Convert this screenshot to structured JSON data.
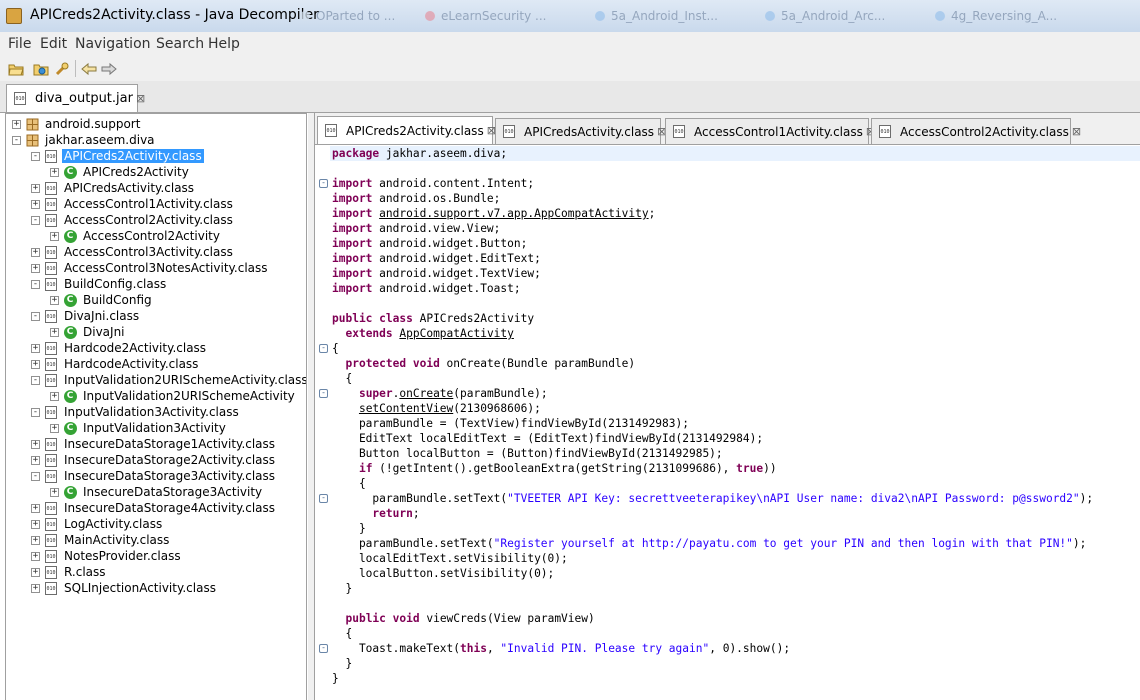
{
  "window": {
    "title": "APICreds2Activity.class - Java Decompiler",
    "background_tabs": [
      "OParted to ...",
      "eLearnSecurity ...",
      "5a_Android_Inst...",
      "5a_Android_Arc...",
      "4g_Reversing_A..."
    ]
  },
  "menu": [
    "File",
    "Edit",
    "Navigation",
    "Search",
    "Help"
  ],
  "toolbar": {
    "buttons": [
      "open-file-icon",
      "open-type-icon",
      "search-icon",
      "back-arrow-icon",
      "forward-arrow-icon"
    ]
  },
  "outer_tab": {
    "label": "diva_output.jar",
    "close": "⊠"
  },
  "tree": [
    {
      "indent": 0,
      "toggle": "+",
      "icon": "package",
      "label": "android.support"
    },
    {
      "indent": 0,
      "toggle": "-",
      "icon": "package",
      "label": "jakhar.aseem.diva"
    },
    {
      "indent": 1,
      "toggle": "-",
      "icon": "file",
      "label": "APICreds2Activity.class",
      "selected": true
    },
    {
      "indent": 2,
      "toggle": "+",
      "icon": "class",
      "label": "APICreds2Activity"
    },
    {
      "indent": 1,
      "toggle": "+",
      "icon": "file",
      "label": "APICredsActivity.class"
    },
    {
      "indent": 1,
      "toggle": "+",
      "icon": "file",
      "label": "AccessControl1Activity.class"
    },
    {
      "indent": 1,
      "toggle": "-",
      "icon": "file",
      "label": "AccessControl2Activity.class"
    },
    {
      "indent": 2,
      "toggle": "+",
      "icon": "class",
      "label": "AccessControl2Activity"
    },
    {
      "indent": 1,
      "toggle": "+",
      "icon": "file",
      "label": "AccessControl3Activity.class"
    },
    {
      "indent": 1,
      "toggle": "+",
      "icon": "file",
      "label": "AccessControl3NotesActivity.class"
    },
    {
      "indent": 1,
      "toggle": "-",
      "icon": "file",
      "label": "BuildConfig.class"
    },
    {
      "indent": 2,
      "toggle": "+",
      "icon": "class",
      "label": "BuildConfig"
    },
    {
      "indent": 1,
      "toggle": "-",
      "icon": "file",
      "label": "DivaJni.class"
    },
    {
      "indent": 2,
      "toggle": "+",
      "icon": "class",
      "label": "DivaJni"
    },
    {
      "indent": 1,
      "toggle": "+",
      "icon": "file",
      "label": "Hardcode2Activity.class"
    },
    {
      "indent": 1,
      "toggle": "+",
      "icon": "file",
      "label": "HardcodeActivity.class"
    },
    {
      "indent": 1,
      "toggle": "-",
      "icon": "file",
      "label": "InputValidation2URISchemeActivity.class"
    },
    {
      "indent": 2,
      "toggle": "+",
      "icon": "class",
      "label": "InputValidation2URISchemeActivity"
    },
    {
      "indent": 1,
      "toggle": "-",
      "icon": "file",
      "label": "InputValidation3Activity.class"
    },
    {
      "indent": 2,
      "toggle": "+",
      "icon": "class",
      "label": "InputValidation3Activity"
    },
    {
      "indent": 1,
      "toggle": "+",
      "icon": "file",
      "label": "InsecureDataStorage1Activity.class"
    },
    {
      "indent": 1,
      "toggle": "+",
      "icon": "file",
      "label": "InsecureDataStorage2Activity.class"
    },
    {
      "indent": 1,
      "toggle": "-",
      "icon": "file",
      "label": "InsecureDataStorage3Activity.class"
    },
    {
      "indent": 2,
      "toggle": "+",
      "icon": "class",
      "label": "InsecureDataStorage3Activity"
    },
    {
      "indent": 1,
      "toggle": "+",
      "icon": "file",
      "label": "InsecureDataStorage4Activity.class"
    },
    {
      "indent": 1,
      "toggle": "+",
      "icon": "file",
      "label": "LogActivity.class"
    },
    {
      "indent": 1,
      "toggle": "+",
      "icon": "file",
      "label": "MainActivity.class"
    },
    {
      "indent": 1,
      "toggle": "+",
      "icon": "file",
      "label": "NotesProvider.class"
    },
    {
      "indent": 1,
      "toggle": "+",
      "icon": "file",
      "label": "R.class"
    },
    {
      "indent": 1,
      "toggle": "+",
      "icon": "file",
      "label": "SQLInjectionActivity.class"
    }
  ],
  "editor_tabs": [
    {
      "label": "APICreds2Activity.class",
      "active": true
    },
    {
      "label": "APICredsActivity.class",
      "active": false
    },
    {
      "label": "AccessControl1Activity.class",
      "active": false
    },
    {
      "label": "AccessControl2Activity.class",
      "active": false
    }
  ],
  "code": [
    {
      "text": "package jakhar.aseem.diva;",
      "highlight": true
    },
    {
      "text": ""
    },
    {
      "text": "import android.content.Intent;",
      "fold": "-"
    },
    {
      "text": "import android.os.Bundle;"
    },
    {
      "text": "import android.support.v7.app.AppCompatActivity;"
    },
    {
      "text": "import android.view.View;"
    },
    {
      "text": "import android.widget.Button;"
    },
    {
      "text": "import android.widget.EditText;"
    },
    {
      "text": "import android.widget.TextView;"
    },
    {
      "text": "import android.widget.Toast;"
    },
    {
      "text": ""
    },
    {
      "text": "public class APICreds2Activity"
    },
    {
      "text": "  extends AppCompatActivity"
    },
    {
      "text": "{",
      "fold": "-"
    },
    {
      "text": "  protected void onCreate(Bundle paramBundle)"
    },
    {
      "text": "  {"
    },
    {
      "text": "    super.onCreate(paramBundle);",
      "fold": "-"
    },
    {
      "text": "    setContentView(2130968606);"
    },
    {
      "text": "    paramBundle = (TextView)findViewById(2131492983);"
    },
    {
      "text": "    EditText localEditText = (EditText)findViewById(2131492984);"
    },
    {
      "text": "    Button localButton = (Button)findViewById(2131492985);"
    },
    {
      "text": "    if (!getIntent().getBooleanExtra(getString(2131099686), true))"
    },
    {
      "text": "    {"
    },
    {
      "text": "      paramBundle.setText(\"TVEETER API Key: secrettveeterapikey\\nAPI User name: diva2\\nAPI Password: p@ssword2\");",
      "fold": "-"
    },
    {
      "text": "      return;"
    },
    {
      "text": "    }"
    },
    {
      "text": "    paramBundle.setText(\"Register yourself at http://payatu.com to get your PIN and then login with that PIN!\");"
    },
    {
      "text": "    localEditText.setVisibility(0);"
    },
    {
      "text": "    localButton.setVisibility(0);"
    },
    {
      "text": "  }"
    },
    {
      "text": ""
    },
    {
      "text": "  public void viewCreds(View paramView)"
    },
    {
      "text": "  {"
    },
    {
      "text": "    Toast.makeText(this, \"Invalid PIN. Please try again\", 0).show();",
      "fold": "-"
    },
    {
      "text": "  }"
    },
    {
      "text": "}"
    }
  ],
  "colors": {
    "keyword": "#7f0055",
    "string": "#2a00ff",
    "selection": "#3399ff",
    "class_icon": "#35a335",
    "line_highlight": "#e8f2fe"
  }
}
